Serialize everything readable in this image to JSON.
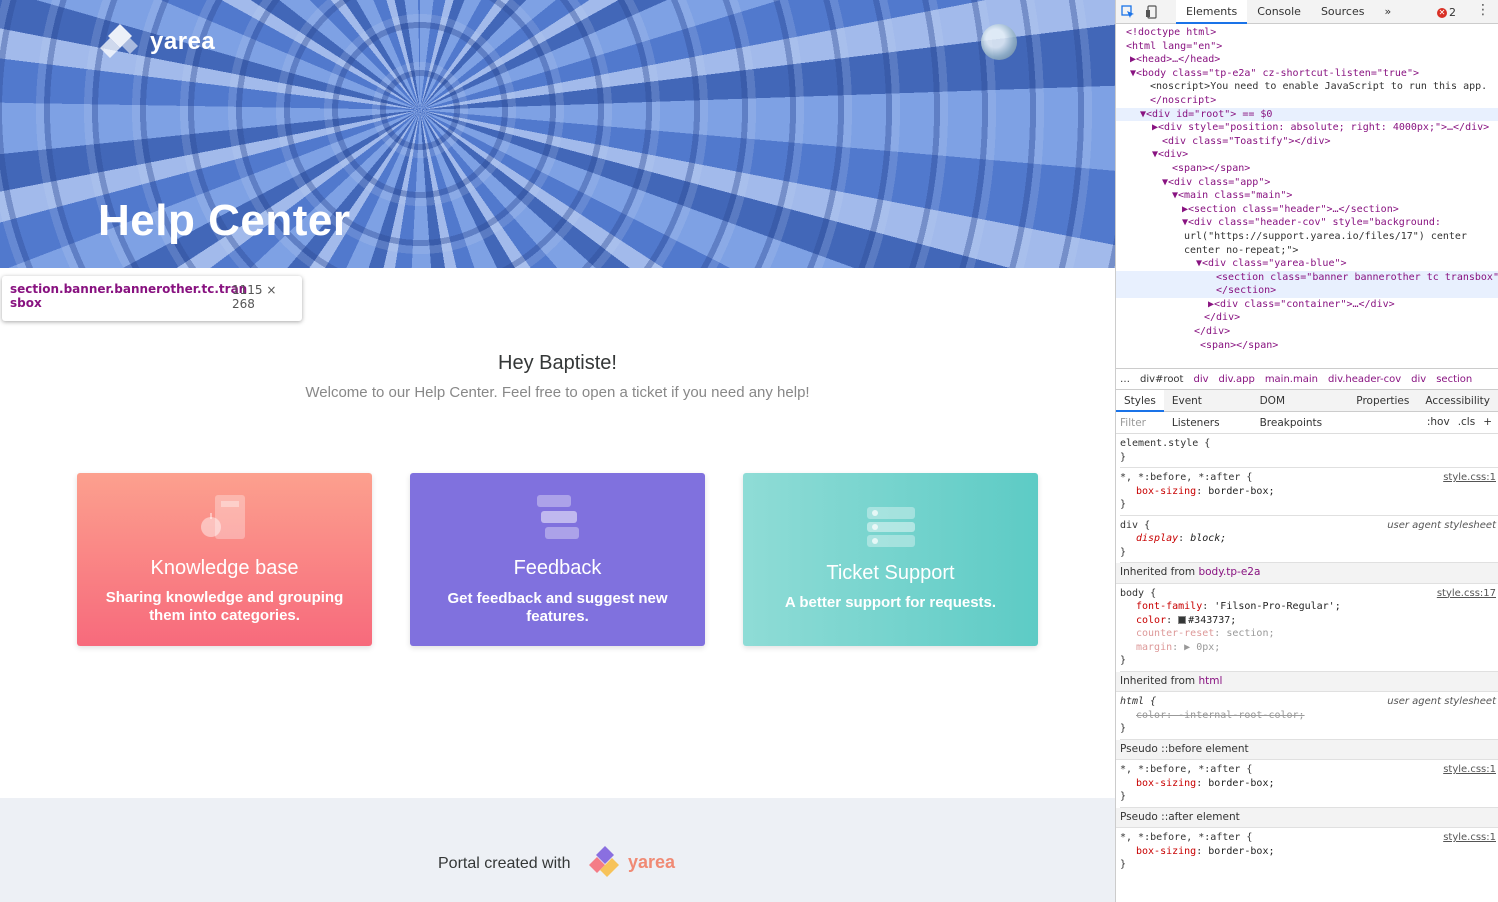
{
  "banner": {
    "brand": "yarea",
    "title": "Help Center"
  },
  "inspect_tooltip": {
    "selector_line1": "section.banner.bannerother.tc.tran",
    "selector_line2": "sbox",
    "size": "1115 × 268"
  },
  "greeting": {
    "title": "Hey Baptiste!",
    "subtitle": "Welcome to our Help Center. Feel free to open a ticket if you need any help!"
  },
  "cards": [
    {
      "title": "Knowledge base",
      "desc": "Sharing knowledge and grouping them into categories.",
      "icon": "book-apple-icon"
    },
    {
      "title": "Feedback",
      "desc": "Get feedback and suggest new features.",
      "icon": "chat-bubbles-icon"
    },
    {
      "title": "Ticket Support",
      "desc": "A better support for requests.",
      "icon": "ticket-list-icon"
    }
  ],
  "footer": {
    "text": "Portal created with",
    "brand": "yarea"
  },
  "devtools": {
    "tabs": [
      "Elements",
      "Console",
      "Sources"
    ],
    "more": "»",
    "errors": "2",
    "dom_lines": [
      {
        "text": "<!doctype html>"
      },
      {
        "text": "<html lang=\"en\">"
      },
      {
        "text": "▶<head>…</head>"
      },
      {
        "text": "▼<body class=\"tp-e2a\" cz-shortcut-listen=\"true\">"
      },
      {
        "text": "<noscript>You need to enable JavaScript to run this app."
      },
      {
        "text": "</noscript>"
      },
      {
        "text": "▼<div id=\"root\"> == $0"
      },
      {
        "text": "▶<div style=\"position: absolute; right: 4000px;\">…</div>"
      },
      {
        "text": "<div class=\"Toastify\"></div>"
      },
      {
        "text": "▼<div>"
      },
      {
        "text": "<span></span>"
      },
      {
        "text": "▼<div class=\"app\">"
      },
      {
        "text": "▼<main class=\"main\">"
      },
      {
        "text": "▶<section class=\"header\">…</section>"
      },
      {
        "text": "▼<div class=\"header-cov\" style=\"background:"
      },
      {
        "text": "url(\"https://support.yarea.io/files/17\") center"
      },
      {
        "text": "center no-repeat;\">"
      },
      {
        "text": "▼<div class=\"yarea-blue\">"
      },
      {
        "text": "<section class=\"banner bannerother tc transbox\">"
      },
      {
        "text": "</section>"
      },
      {
        "text": "▶<div class=\"container\">…</div>"
      },
      {
        "text": "</div>"
      },
      {
        "text": "</div>"
      },
      {
        "text": "<span></span>"
      }
    ],
    "dom_more": "…",
    "breadcrumbs": [
      "div#root",
      "div",
      "div.app",
      "main.main",
      "div.header-cov",
      "div",
      "section"
    ],
    "subtabs": [
      "Styles",
      "Event Listeners",
      "DOM Breakpoints",
      "Properties",
      "Accessibility"
    ],
    "filter_placeholder": "Filter",
    "filter_hov": ":hov",
    "filter_cls": ".cls",
    "filter_add": "+",
    "rules": {
      "element_style": "element.style {",
      "close": "}",
      "universal_selector": "*, *:before, *:after {",
      "box_sizing_prop": "box-sizing",
      "box_sizing_val": "border-box;",
      "style_css_1": "style.css:1",
      "div_selector": "div {",
      "display_prop": "display",
      "display_val": "block;",
      "ua": "user agent stylesheet",
      "inherited_from": "Inherited from",
      "body_class": "body.tp-e2a",
      "body_selector": "body {",
      "style_css_17": "style.css:17",
      "font_family_prop": "font-family",
      "font_family_val": "'Filson-Pro-Regular';",
      "color_prop": "color",
      "color_val": "#343737;",
      "counter_reset_prop": "counter-reset",
      "counter_reset_val": "section;",
      "margin_prop": "margin",
      "margin_val": "▶ 0px;",
      "html_tag": "html",
      "html_selector": "html {",
      "html_color": "color: -internal-root-color;",
      "pseudo_before": "Pseudo ::before element",
      "pseudo_after": "Pseudo ::after element"
    }
  },
  "colors": {
    "kb_card": "#f76a7c",
    "feedback_card": "#8071de",
    "ticket_card": "#5dcbc5",
    "footer_bg": "#edf0f5",
    "text": "#343737"
  }
}
